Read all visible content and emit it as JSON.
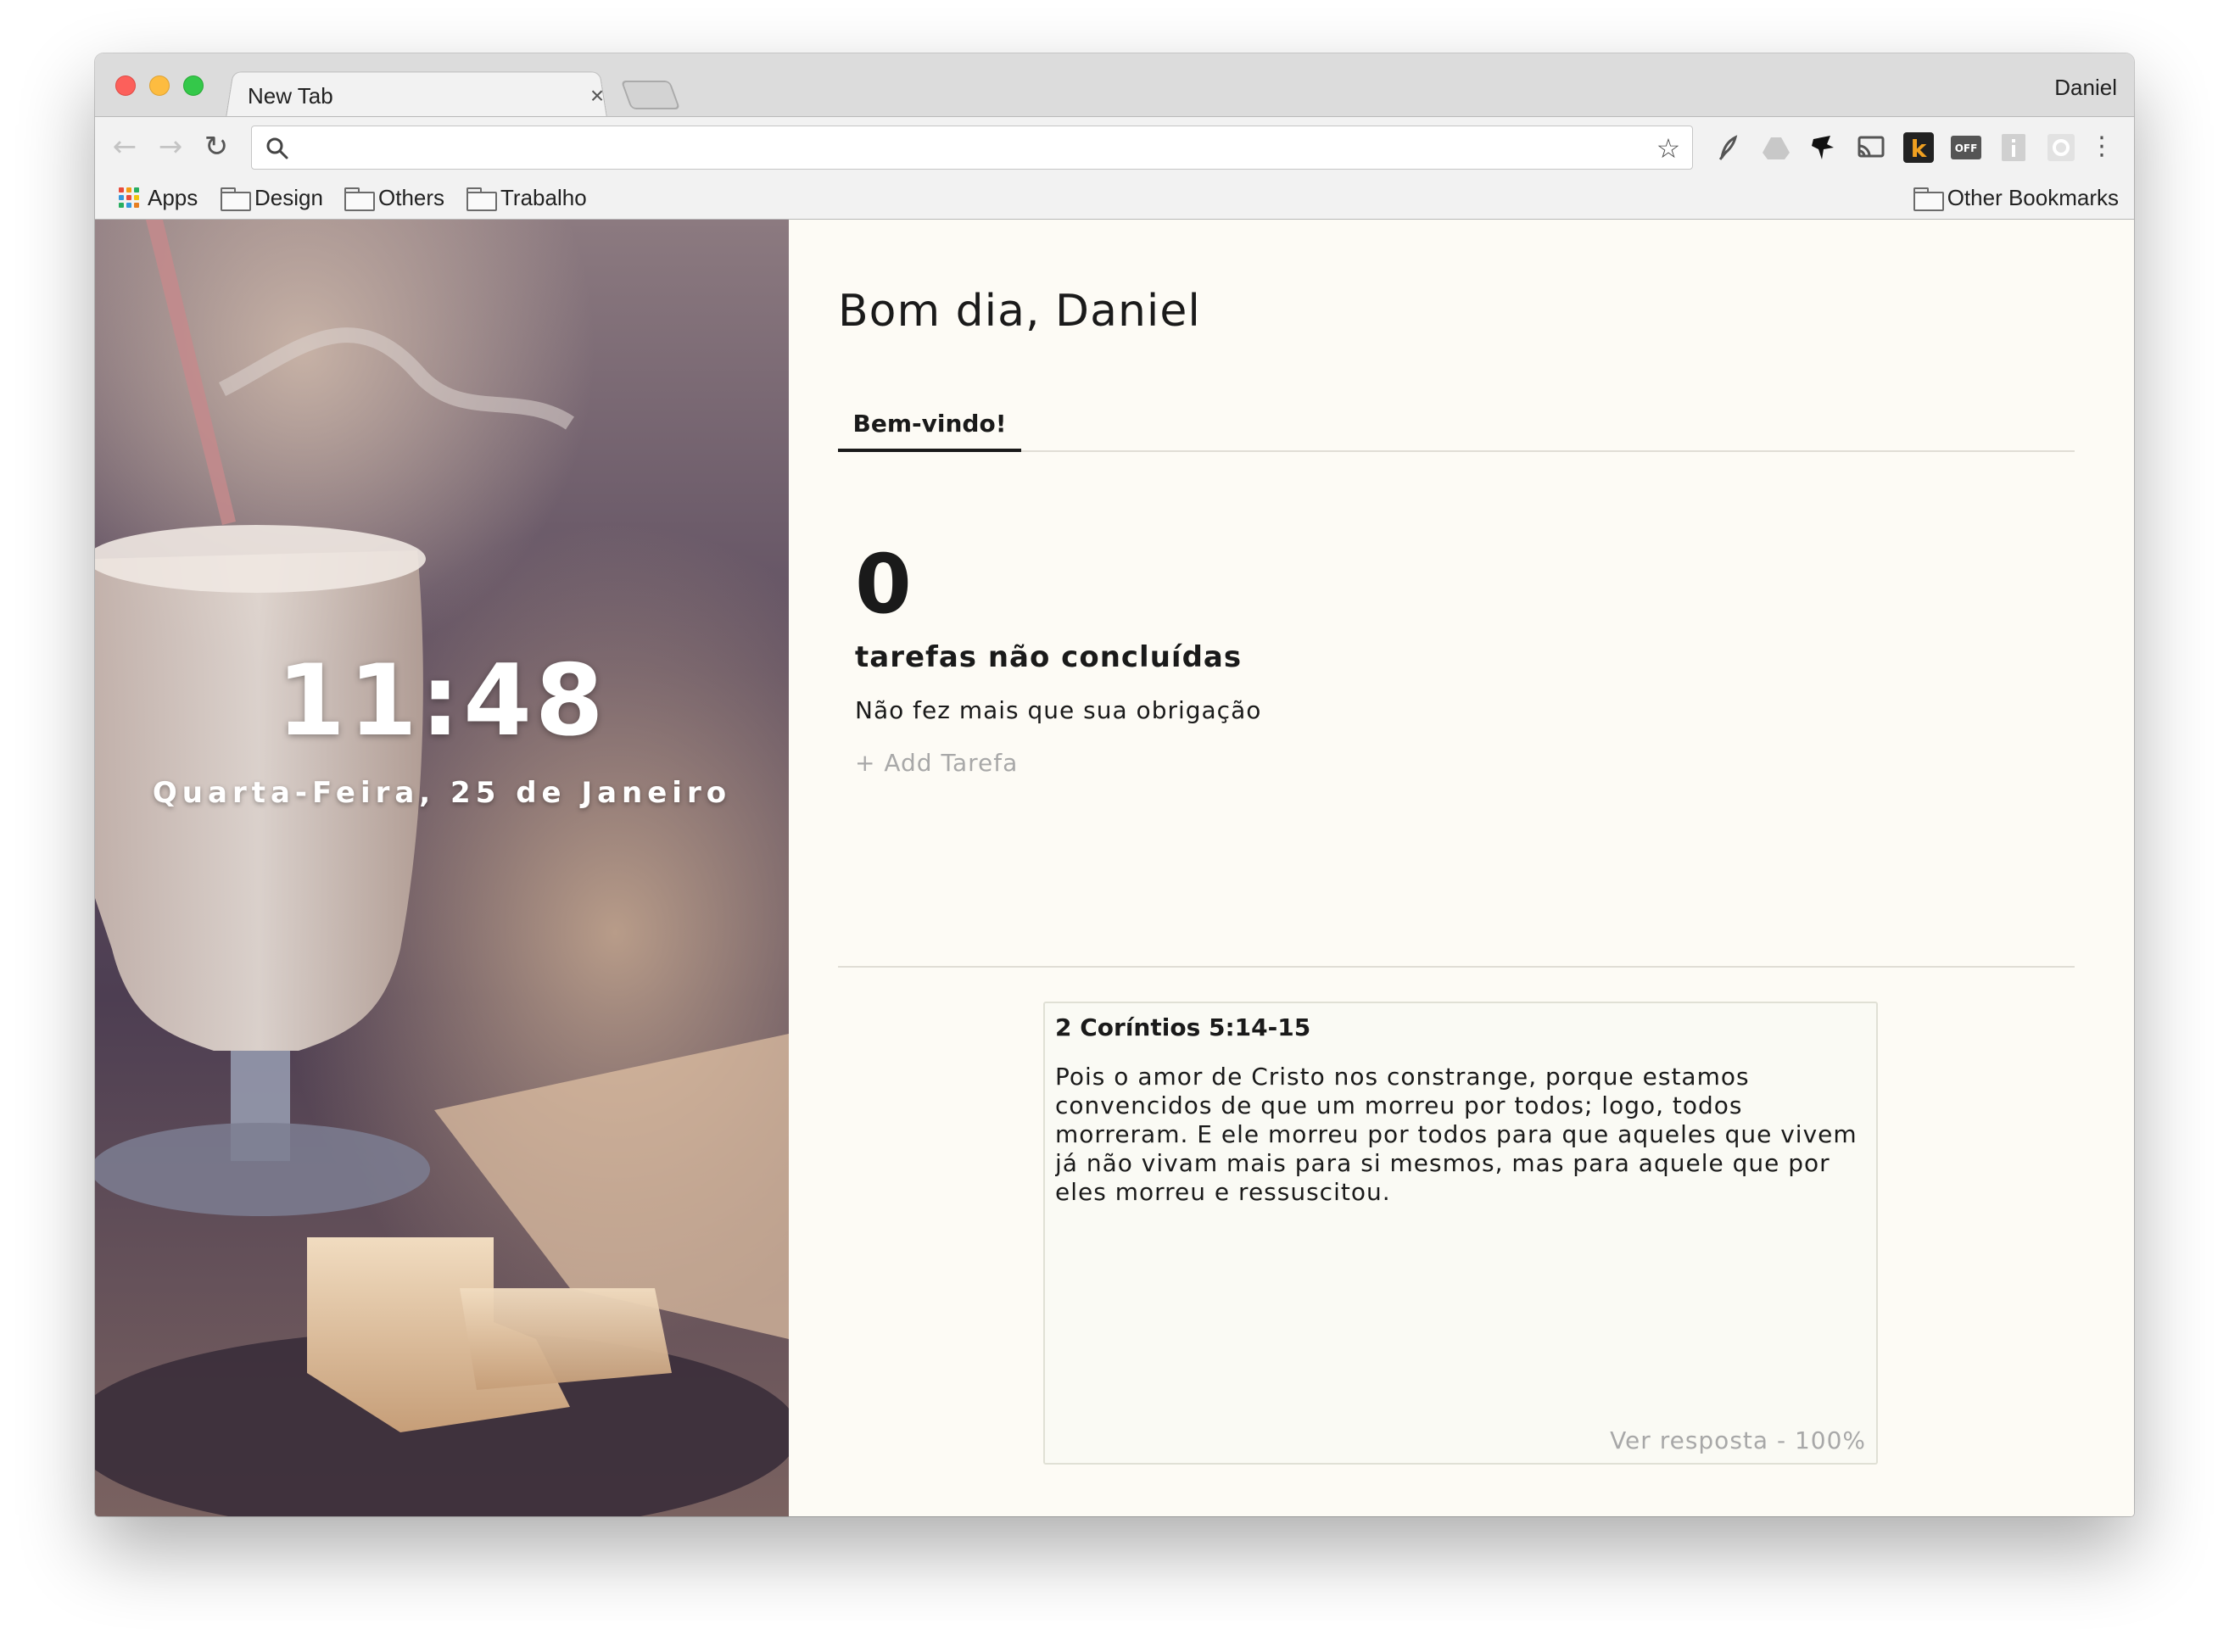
{
  "browser": {
    "tab_title": "New Tab",
    "tab_close": "×",
    "profile_name": "Daniel",
    "omnibox_value": "",
    "bookmarks": {
      "apps_label": "Apps",
      "folders": [
        "Design",
        "Others",
        "Trabalho"
      ],
      "other_label": "Other Bookmarks"
    }
  },
  "clock": {
    "time": "11:48",
    "date": "Quarta-Feira, 25 de Janeiro"
  },
  "dashboard": {
    "greeting": "Bom dia, Daniel",
    "tab_label": "Bem-vindo!",
    "tasks": {
      "count": "0",
      "label": "tarefas não concluídas",
      "message": "Não fez mais que sua obrigação",
      "add_label": "+ Add Tarefa"
    },
    "verse": {
      "reference": "2 Coríntios 5:14-15",
      "text": "Pois o amor de Cristo nos constrange, porque estamos convencidos de que um morreu por todos; logo, todos morreram. E ele morreu por todos para que aqueles que vivem já não vivam mais para si mesmos, mas para aquele que por eles morreu e ressuscitou.",
      "answer_label": "Ver resposta - 100%"
    }
  },
  "colors": {
    "page_bg": "#fdfbf5",
    "text": "#1a1a1a",
    "muted": "#a8a8a8"
  }
}
